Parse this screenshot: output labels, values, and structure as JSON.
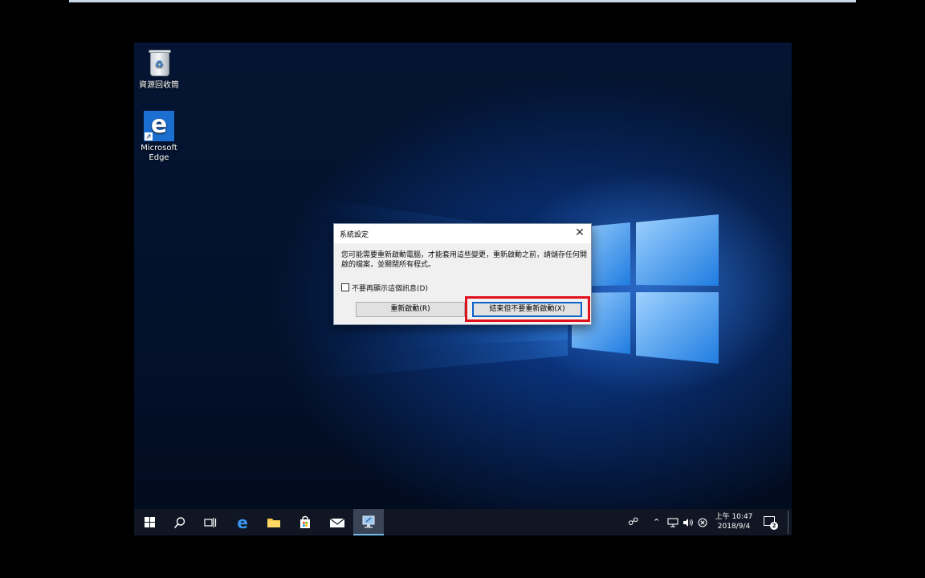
{
  "desktop": {
    "icons": [
      {
        "label": "資源回收筒"
      },
      {
        "label_line1": "Microsoft",
        "label_line2": "Edge"
      }
    ]
  },
  "dialog": {
    "title": "系統設定",
    "message": "您可能需要重新啟動電腦，才能套用這些變更，重新啟動之前，請儲存任何開啟的檔案，並關閉所有程式。",
    "checkbox_label": "不要再顯示這個訊息(D)",
    "checkbox_checked": false,
    "restart_button": "重新啟動(R)",
    "exit_button": "結束但不要重新啟動(X)",
    "close_glyph": "✕"
  },
  "taskbar": {
    "clock_time": "上午 10:47",
    "clock_date": "2018/9/4",
    "notification_count": "2"
  },
  "colors": {
    "highlight": "#e0101c",
    "accent": "#0b64c8",
    "taskbar": "#101623"
  }
}
